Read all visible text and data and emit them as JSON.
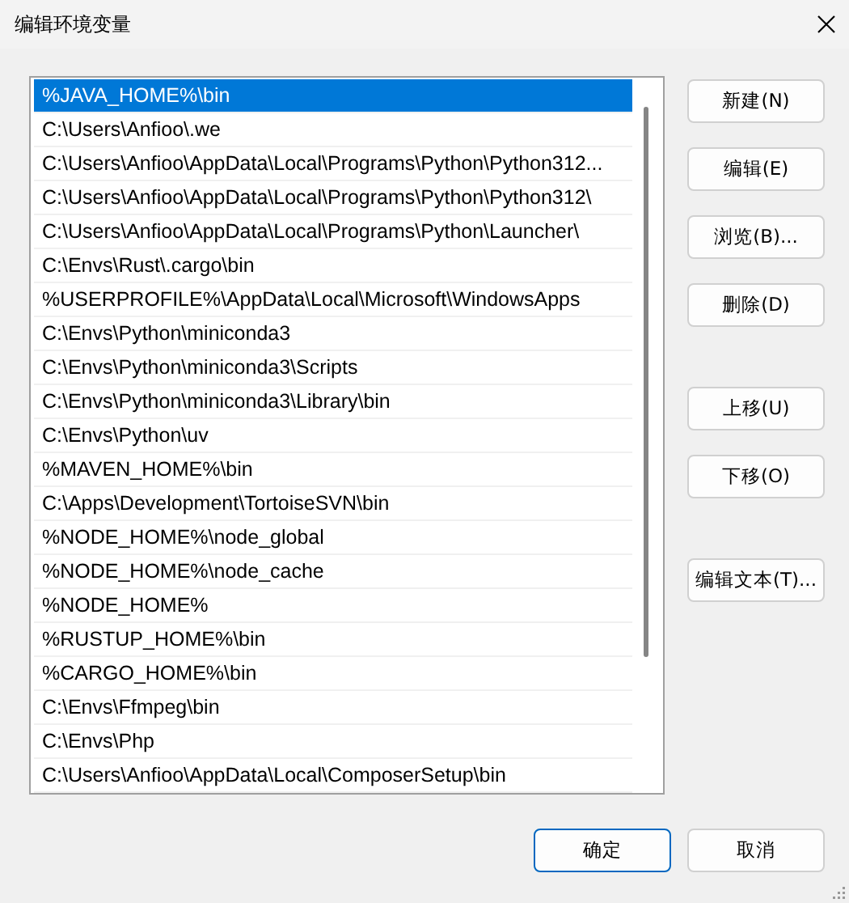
{
  "window": {
    "title": "编辑环境变量"
  },
  "paths": [
    {
      "text": "%JAVA_HOME%\\bin",
      "selected": true
    },
    {
      "text": "C:\\Users\\Anfioo\\.we",
      "selected": false
    },
    {
      "text": "C:\\Users\\Anfioo\\AppData\\Local\\Programs\\Python\\Python312...",
      "selected": false
    },
    {
      "text": "C:\\Users\\Anfioo\\AppData\\Local\\Programs\\Python\\Python312\\",
      "selected": false
    },
    {
      "text": "C:\\Users\\Anfioo\\AppData\\Local\\Programs\\Python\\Launcher\\",
      "selected": false
    },
    {
      "text": "C:\\Envs\\Rust\\.cargo\\bin",
      "selected": false
    },
    {
      "text": "%USERPROFILE%\\AppData\\Local\\Microsoft\\WindowsApps",
      "selected": false
    },
    {
      "text": "C:\\Envs\\Python\\miniconda3",
      "selected": false
    },
    {
      "text": "C:\\Envs\\Python\\miniconda3\\Scripts",
      "selected": false
    },
    {
      "text": "C:\\Envs\\Python\\miniconda3\\Library\\bin",
      "selected": false
    },
    {
      "text": "C:\\Envs\\Python\\uv",
      "selected": false
    },
    {
      "text": "%MAVEN_HOME%\\bin",
      "selected": false
    },
    {
      "text": "C:\\Apps\\Development\\TortoiseSVN\\bin",
      "selected": false
    },
    {
      "text": "%NODE_HOME%\\node_global",
      "selected": false
    },
    {
      "text": "%NODE_HOME%\\node_cache",
      "selected": false
    },
    {
      "text": "%NODE_HOME%",
      "selected": false
    },
    {
      "text": "%RUSTUP_HOME%\\bin",
      "selected": false
    },
    {
      "text": "%CARGO_HOME%\\bin",
      "selected": false
    },
    {
      "text": "C:\\Envs\\Ffmpeg\\bin",
      "selected": false
    },
    {
      "text": "C:\\Envs\\Php",
      "selected": false
    },
    {
      "text": "C:\\Users\\Anfioo\\AppData\\Local\\ComposerSetup\\bin",
      "selected": false
    }
  ],
  "button_groups": [
    [
      "新建(N)",
      "编辑(E)",
      "浏览(B)...",
      "删除(D)"
    ],
    [
      "上移(U)",
      "下移(O)"
    ],
    [
      "编辑文本(T)..."
    ]
  ],
  "dialog_buttons": [
    {
      "label": "确定",
      "default": true
    },
    {
      "label": "取消",
      "default": false
    }
  ]
}
